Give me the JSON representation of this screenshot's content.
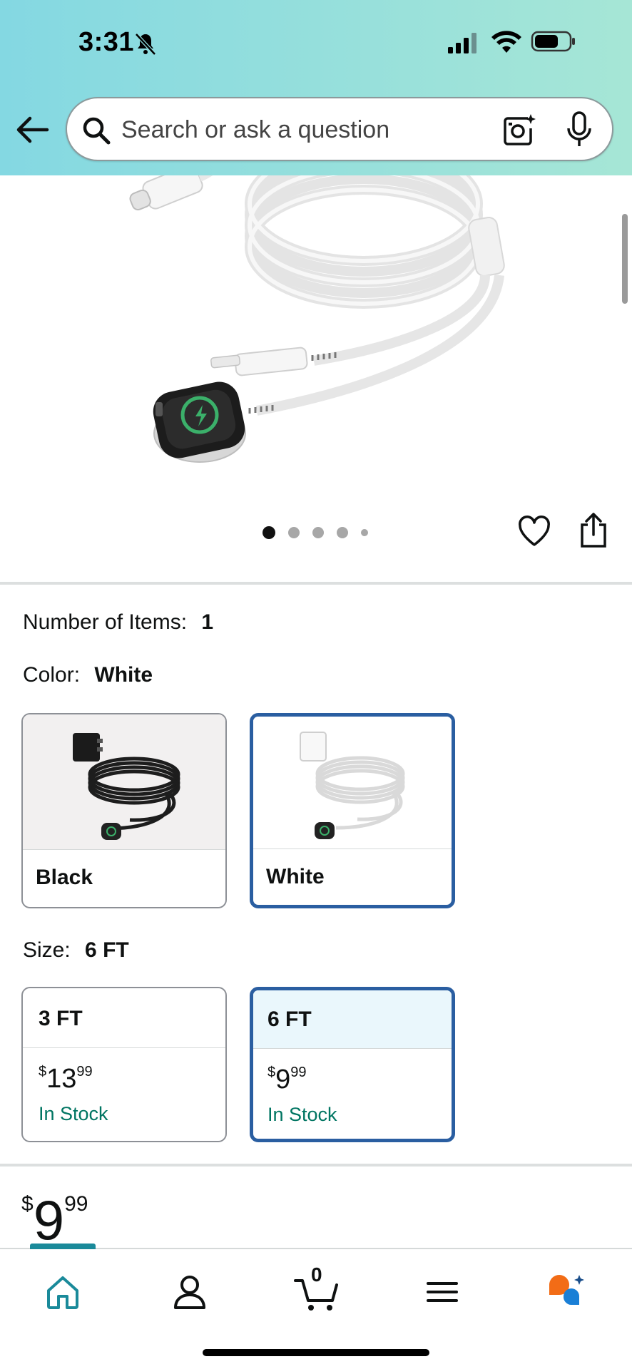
{
  "status_bar": {
    "time": "3:31"
  },
  "search": {
    "placeholder": "Search or ask a question"
  },
  "gallery": {
    "dot_count": 5,
    "active_index": 0
  },
  "options": {
    "items_label": "Number of Items:",
    "items_value": "1",
    "color_label": "Color:",
    "color_value": "White",
    "colors": [
      {
        "name": "Black",
        "selected": false
      },
      {
        "name": "White",
        "selected": true
      }
    ],
    "size_label": "Size:",
    "size_value": "6 FT",
    "sizes": [
      {
        "name": "3 FT",
        "price_symbol": "$",
        "price_whole": "13",
        "price_fraction": "99",
        "stock": "In Stock",
        "selected": false
      },
      {
        "name": "6 FT",
        "price_symbol": "$",
        "price_whole": "9",
        "price_fraction": "99",
        "stock": "In Stock",
        "selected": true
      }
    ]
  },
  "price": {
    "symbol": "$",
    "whole": "9",
    "fraction": "99"
  },
  "bottom_nav": {
    "items": [
      "home-icon",
      "account-icon",
      "cart-icon",
      "menu-icon",
      "rufus-icon"
    ],
    "cart_count": "0",
    "active": "home-icon"
  },
  "colors": {
    "accent": "#2a5ea1",
    "stock": "#007562",
    "header_start": "#84d8e2",
    "header_end": "#a6e6d6"
  }
}
